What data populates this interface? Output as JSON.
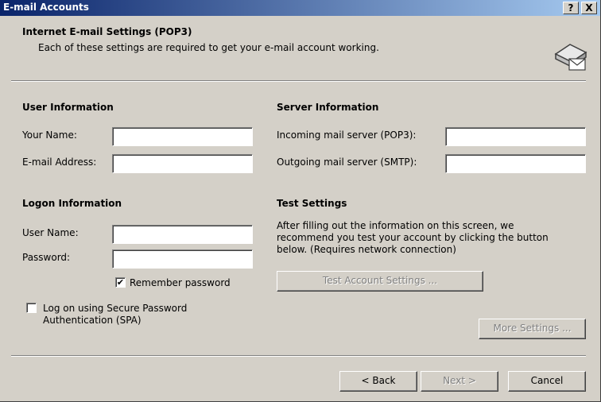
{
  "window": {
    "title": "E-mail Accounts"
  },
  "titlebar_buttons": {
    "help": "?",
    "close": "X"
  },
  "header": {
    "title": "Internet E-mail Settings (POP3)",
    "subtitle": "Each of these settings are required to get your e-mail account working."
  },
  "user_info": {
    "heading": "User Information",
    "your_name_label": "Your Name:",
    "your_name_value": "",
    "email_label": "E-mail Address:",
    "email_value": ""
  },
  "server_info": {
    "heading": "Server Information",
    "incoming_label": "Incoming mail server (POP3):",
    "incoming_value": "",
    "outgoing_label": "Outgoing mail server (SMTP):",
    "outgoing_value": ""
  },
  "logon_info": {
    "heading": "Logon Information",
    "user_name_label": "User Name:",
    "user_name_value": "",
    "password_label": "Password:",
    "password_value": "",
    "remember_label": "Remember password",
    "remember_checked": true,
    "spa_label_line1": "Log on using Secure Password",
    "spa_label_line2": "Authentication (SPA)",
    "spa_checked": false
  },
  "test_settings": {
    "heading": "Test Settings",
    "desc_line1": "After filling out the information on this screen, we",
    "desc_line2": "recommend you test your account by clicking the button",
    "desc_line3": "below. (Requires network connection)",
    "test_button": "Test Account Settings ...",
    "more_button": "More Settings ..."
  },
  "footer": {
    "back": "< Back",
    "next": "Next >",
    "cancel": "Cancel"
  },
  "icons": {
    "header": "envelope-icon",
    "check": "check-icon"
  },
  "colors": {
    "title_start": "#0a246a",
    "title_end": "#a6caf0",
    "face": "#d4d0c8"
  }
}
